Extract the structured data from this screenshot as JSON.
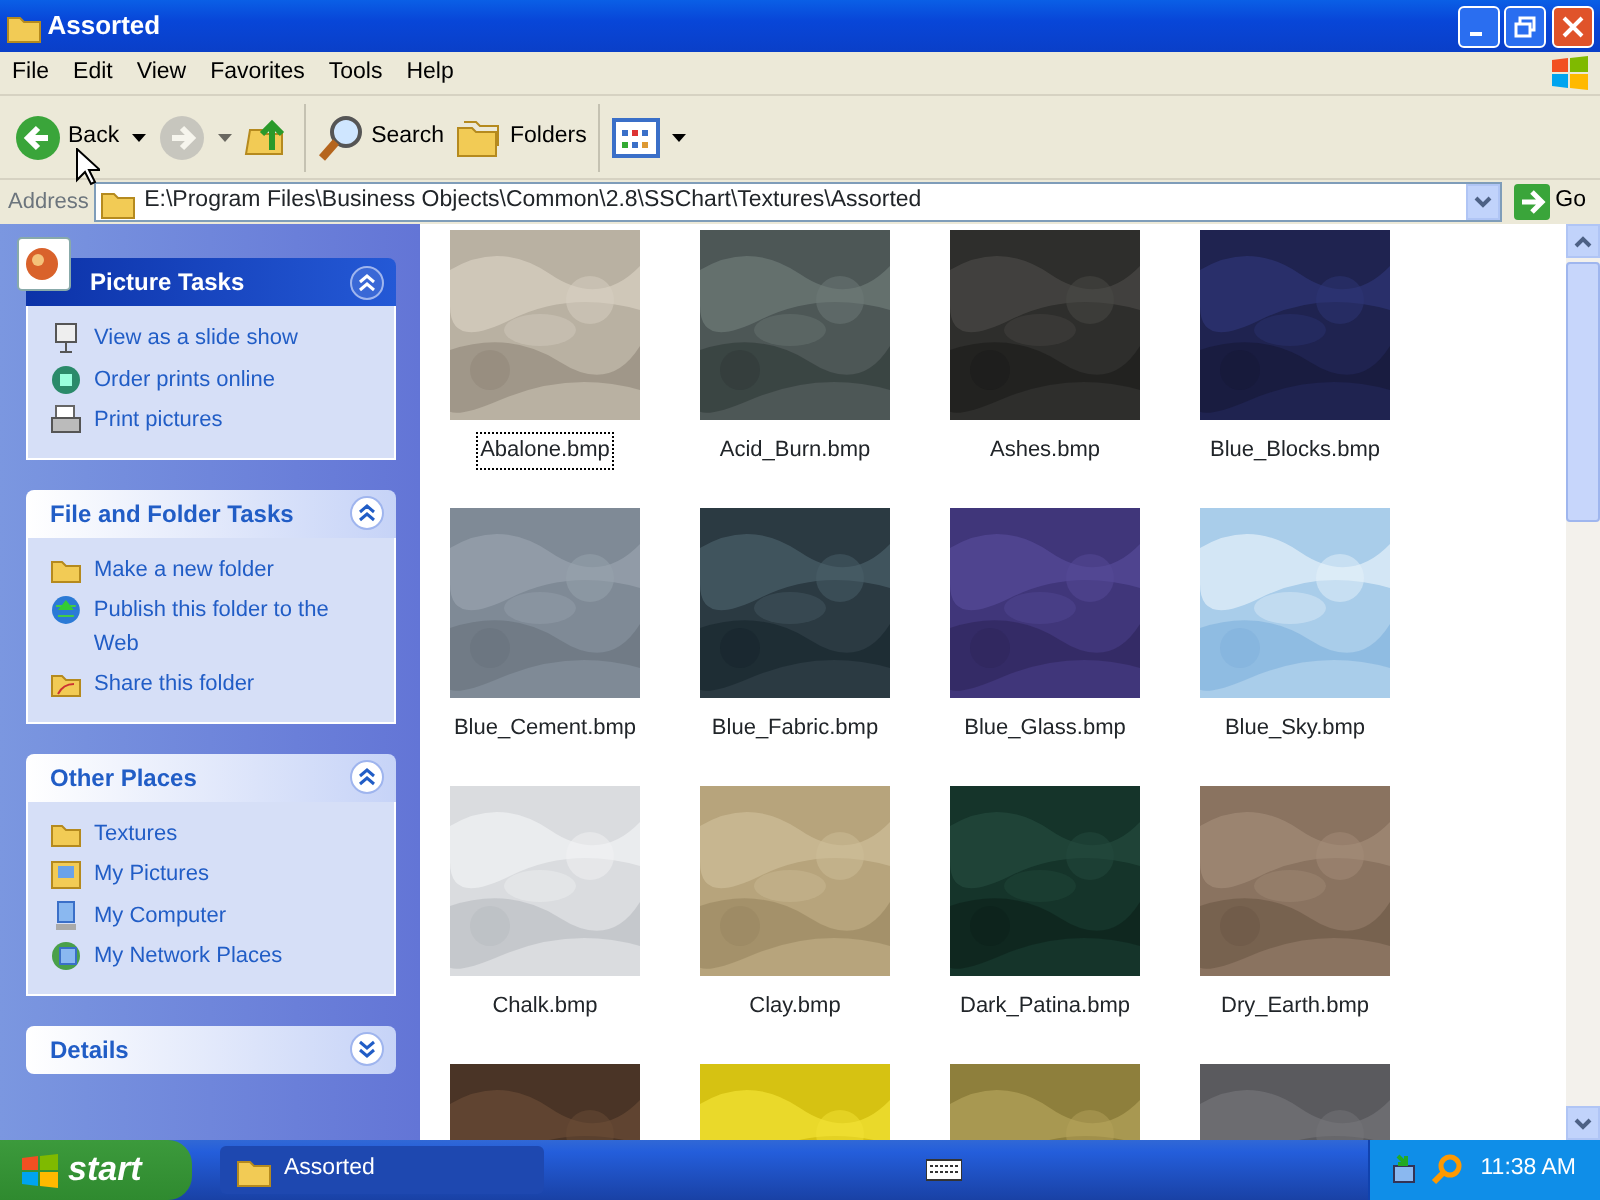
{
  "window": {
    "title": "Assorted"
  },
  "menu": [
    "File",
    "Edit",
    "View",
    "Favorites",
    "Tools",
    "Help"
  ],
  "toolbar": [
    {
      "kind": "back",
      "label": "Back",
      "disabled": false
    },
    {
      "kind": "forward",
      "disabled": true
    },
    {
      "kind": "up",
      "disabled": false
    },
    {
      "kind": "search",
      "label": "Search",
      "disabled": false
    },
    {
      "kind": "folders",
      "label": "Folders",
      "disabled": false
    },
    {
      "kind": "views",
      "disabled": false
    }
  ],
  "address": {
    "label": "Address",
    "value": "E:\\Program Files\\Business Objects\\Common\\2.8\\SSChart\\Textures\\Assorted",
    "go": "Go"
  },
  "sidebar": [
    {
      "title": "Picture Tasks",
      "kind": "special",
      "expanded": true,
      "items": [
        {
          "label": "View as a slide show"
        },
        {
          "label": "Order prints online"
        },
        {
          "label": "Print pictures"
        }
      ]
    },
    {
      "title": "File and Folder Tasks",
      "kind": "normal",
      "expanded": true,
      "items": [
        {
          "label": "Make a new folder"
        },
        {
          "label": "Publish this folder to the Web"
        },
        {
          "label": "Share this folder"
        }
      ]
    },
    {
      "title": "Other Places",
      "kind": "normal",
      "expanded": true,
      "items": [
        {
          "label": "Textures"
        },
        {
          "label": "My Pictures"
        },
        {
          "label": "My Computer"
        },
        {
          "label": "My Network Places"
        }
      ]
    },
    {
      "title": "Details",
      "kind": "normal",
      "expanded": false
    }
  ],
  "files": [
    {
      "name": "Abalone.bmp",
      "focused": true
    },
    {
      "name": "Acid_Burn.bmp",
      "focused": false
    },
    {
      "name": "Ashes.bmp",
      "focused": false
    },
    {
      "name": "Blue_Blocks.bmp",
      "focused": false
    },
    {
      "name": "Blue_Cement.bmp",
      "focused": false
    },
    {
      "name": "Blue_Fabric.bmp",
      "focused": false
    },
    {
      "name": "Blue_Glass.bmp",
      "focused": false
    },
    {
      "name": "Blue_Sky.bmp",
      "focused": false
    },
    {
      "name": "Chalk.bmp",
      "focused": false
    },
    {
      "name": "Clay.bmp",
      "focused": false
    },
    {
      "name": "Dark_Patina.bmp",
      "focused": false
    },
    {
      "name": "Dry_Earth.bmp",
      "focused": false
    },
    {
      "kind": "picture"
    },
    {
      "kind": "picture"
    },
    {
      "kind": "picture"
    },
    {
      "kind": "picture"
    }
  ],
  "taskbar": {
    "start": "start",
    "tasks": [
      {
        "label": "Assorted",
        "selected": true
      }
    ],
    "clock": "11:38 AM"
  }
}
